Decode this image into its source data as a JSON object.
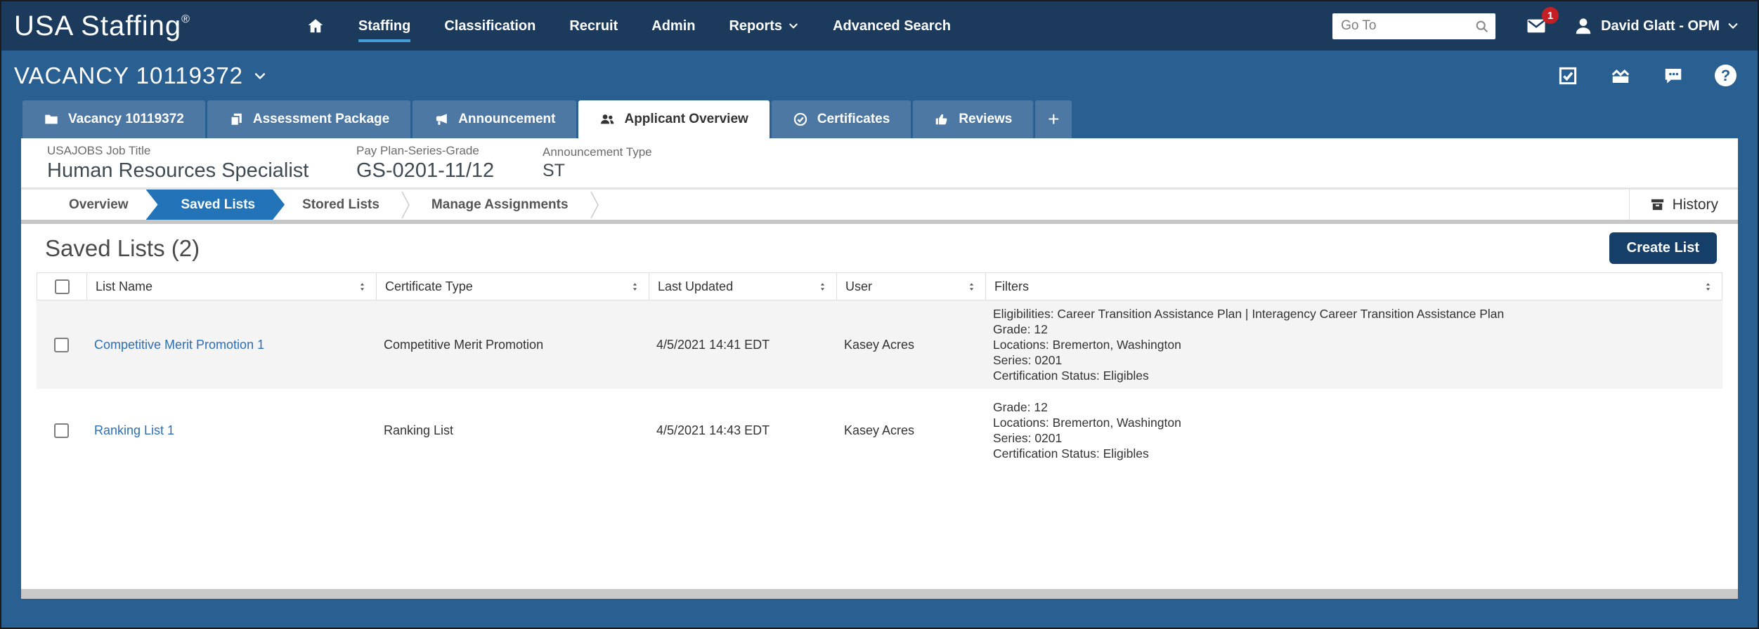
{
  "header": {
    "logo": "USA Staffing",
    "registered_mark": "®",
    "nav": [
      {
        "label": "Staffing",
        "active": true
      },
      {
        "label": "Classification",
        "active": false
      },
      {
        "label": "Recruit",
        "active": false
      },
      {
        "label": "Admin",
        "active": false
      },
      {
        "label": "Reports",
        "active": false,
        "has_dropdown": true
      },
      {
        "label": "Advanced Search",
        "active": false
      }
    ],
    "goto_placeholder": "Go To",
    "notification_count": "1",
    "user_name": "David Glatt - OPM"
  },
  "vacancy_bar": {
    "title": "VACANCY 10119372"
  },
  "tabs": [
    {
      "label": "Vacancy 10119372",
      "icon": "folder-icon",
      "active": false
    },
    {
      "label": "Assessment Package",
      "icon": "copy-icon",
      "active": false
    },
    {
      "label": "Announcement",
      "icon": "megaphone-icon",
      "active": false
    },
    {
      "label": "Applicant Overview",
      "icon": "people-icon",
      "active": true
    },
    {
      "label": "Certificates",
      "icon": "certificate-check-icon",
      "active": false
    },
    {
      "label": "Reviews",
      "icon": "thumbs-up-icon",
      "active": false
    }
  ],
  "add_tab_label": "+",
  "help_glyph": "?",
  "job_info": {
    "fields": [
      {
        "label": "USAJOBS Job Title",
        "value": "Human Resources Specialist"
      },
      {
        "label": "Pay Plan-Series-Grade",
        "value": "GS-0201-11/12"
      },
      {
        "label": "Announcement Type",
        "value": "ST"
      }
    ]
  },
  "subtabs": {
    "items": [
      {
        "label": "Overview",
        "active": false
      },
      {
        "label": "Saved Lists",
        "active": true
      },
      {
        "label": "Stored Lists",
        "active": false
      },
      {
        "label": "Manage Assignments",
        "active": false
      }
    ],
    "history_label": "History"
  },
  "main": {
    "title": "Saved Lists (2)",
    "create_button_label": "Create List",
    "table": {
      "columns": [
        "List Name",
        "Certificate Type",
        "Last Updated",
        "User",
        "Filters"
      ],
      "rows": [
        {
          "list_name": "Competitive Merit Promotion 1",
          "certificate_type": "Competitive Merit Promotion",
          "last_updated": "4/5/2021 14:41 EDT",
          "user": "Kasey Acres",
          "filters": [
            "Eligibilities: Career Transition Assistance Plan | Interagency Career Transition Assistance Plan",
            "Grade: 12",
            "Locations: Bremerton, Washington",
            "Series: 0201",
            "Certification Status: Eligibles"
          ]
        },
        {
          "list_name": "Ranking List 1",
          "certificate_type": "Ranking List",
          "last_updated": "4/5/2021 14:43 EDT",
          "user": "Kasey Acres",
          "filters": [
            "Grade: 12",
            "Locations: Bremerton, Washington",
            "Series: 0201",
            "Certification Status: Eligibles"
          ]
        }
      ]
    }
  },
  "colors": {
    "topnav": "#1c3b5c",
    "bar_blue": "#2a5f92",
    "tab_inactive": "#4d78a3",
    "nav_underline": "#459fd7",
    "active_crumb": "#2273b8",
    "link": "#2d6eb2",
    "create_button": "#153f68",
    "badge": "#c32026",
    "row_stripe": "#f4f4f4"
  }
}
